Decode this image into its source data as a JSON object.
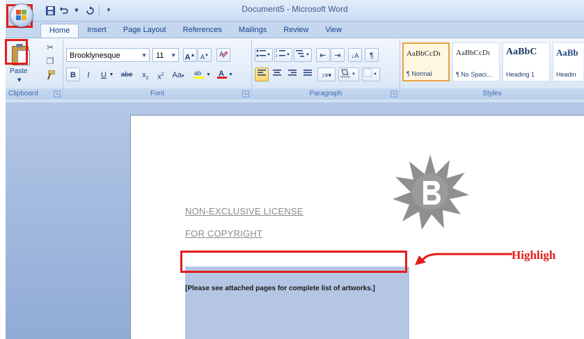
{
  "window": {
    "title": "Document5 - Microsoft Word"
  },
  "quick_access": {
    "save_icon": "save-icon",
    "undo_icon": "undo-icon",
    "redo_icon": "redo-icon",
    "customize_icon": "customize-qat-icon"
  },
  "tabs": [
    {
      "label": "Home",
      "active": true
    },
    {
      "label": "Insert"
    },
    {
      "label": "Page Layout"
    },
    {
      "label": "References"
    },
    {
      "label": "Mailings"
    },
    {
      "label": "Review"
    },
    {
      "label": "View"
    }
  ],
  "ribbon": {
    "clipboard": {
      "label": "Clipboard",
      "paste_label": "Paste"
    },
    "font": {
      "label": "Font",
      "font_name": "Brooklynesque",
      "font_size": "11",
      "bold": "B",
      "italic": "I",
      "underline": "U",
      "strikethrough": "abe",
      "subscript": "x",
      "superscript": "x",
      "change_case": "Aa",
      "grow": "A",
      "shrink": "A"
    },
    "paragraph": {
      "label": "Paragraph"
    },
    "styles": {
      "label": "Styles",
      "items": [
        {
          "sample": "AaBbCcDı",
          "name": "¶ Normal",
          "selected": true
        },
        {
          "sample": "AaBbCcDı",
          "name": "¶ No Spaci..."
        },
        {
          "sample": "AaBbC",
          "name": "Heading 1"
        },
        {
          "sample": "AaBb",
          "name": "Headin"
        }
      ]
    }
  },
  "document": {
    "line1": "NON-EXCLUSIVE LICENSE",
    "line2": "FOR COPYRIGHT",
    "note": "[Please see attached pages for complete list of artworks.]"
  },
  "annotation": {
    "label": "Highligh",
    "color": "#e41b1b"
  },
  "colors": {
    "highlight_color": "#ffff00",
    "font_color": "#e02020",
    "doc_blue_block": "#b4c6e4"
  }
}
